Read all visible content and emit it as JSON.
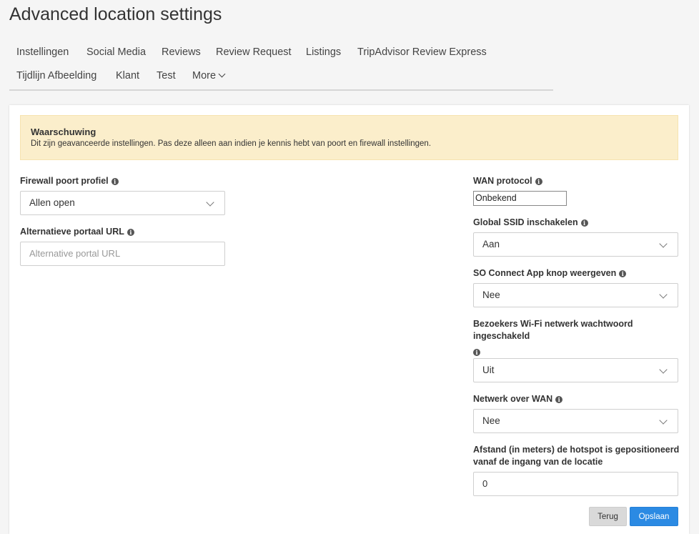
{
  "page": {
    "title": "Advanced location settings"
  },
  "tabs": [
    "Instellingen",
    "Social Media",
    "Reviews",
    "Review Request",
    "Listings",
    "TripAdvisor Review Express",
    "Tijdlijn Afbeelding",
    "Klant",
    "Test"
  ],
  "more_label": "More",
  "alert": {
    "title": "Waarschuwing",
    "text": "Dit zijn geavanceerde instellingen. Pas deze alleen aan indien je kennis hebt van poort en firewall instellingen."
  },
  "left": {
    "firewall": {
      "label": "Firewall poort profiel",
      "value": "Allen open"
    },
    "portal": {
      "label": "Alternatieve portaal URL",
      "placeholder": "Alternative portal URL"
    }
  },
  "right": {
    "wan_protocol": {
      "label": "WAN protocol",
      "value": "Onbekend"
    },
    "global_ssid": {
      "label": "Global SSID inschakelen",
      "value": "Aan"
    },
    "so_connect": {
      "label": "SO Connect App knop weergeven",
      "value": "Nee"
    },
    "visitor_wifi": {
      "label_line1": "Bezoekers Wi-Fi netwerk wachtwoord",
      "label_line2": "ingeschakeld",
      "value": "Uit"
    },
    "network_wan": {
      "label": "Netwerk over WAN",
      "value": "Nee"
    },
    "distance": {
      "label_line1": "Afstand (in meters) de hotspot is gepositioneerd",
      "label_line2": "vanaf de ingang van de locatie",
      "value": "0"
    }
  },
  "buttons": {
    "back": "Terug",
    "save": "Opslaan"
  }
}
